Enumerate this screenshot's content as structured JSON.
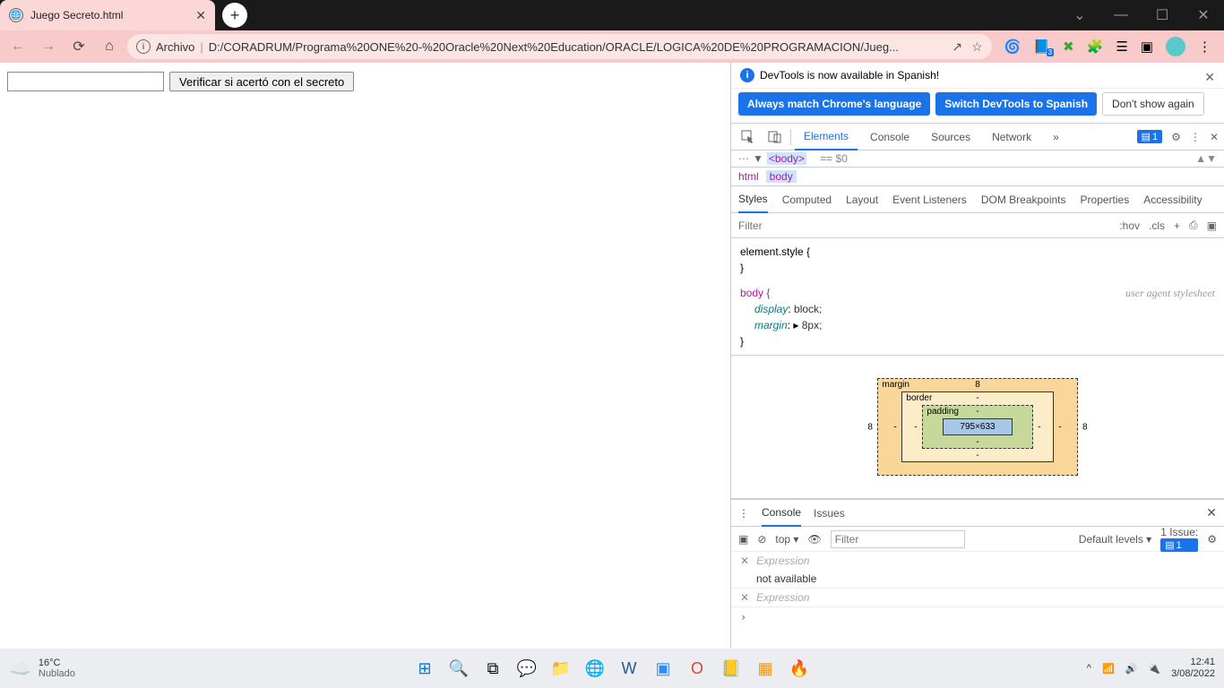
{
  "tab": {
    "title": "Juego Secreto.html"
  },
  "addr": {
    "label": "Archivo",
    "url": "D:/CORADRUM/Programa%20ONE%20-%20Oracle%20Next%20Education/ORACLE/LOGICA%20DE%20PROGRAMACION/Jueg..."
  },
  "page": {
    "button": "Verificar si acertó con el secreto"
  },
  "banner": {
    "text": "DevTools is now available in Spanish!",
    "b1": "Always match Chrome's language",
    "b2": "Switch DevTools to Spanish",
    "b3": "Don't show again"
  },
  "tabs": {
    "elements": "Elements",
    "console": "Console",
    "sources": "Sources",
    "network": "Network",
    "badge": "1"
  },
  "dom": {
    "body": "<body>",
    "eq": "== $0"
  },
  "crumb": {
    "html": "html",
    "body": "body"
  },
  "subtabs": {
    "styles": "Styles",
    "computed": "Computed",
    "layout": "Layout",
    "el": "Event Listeners",
    "db": "DOM Breakpoints",
    "props": "Properties",
    "acc": "Accessibility"
  },
  "filter": {
    "ph": "Filter",
    "hov": ":hov",
    "cls": ".cls"
  },
  "styles": {
    "es": "element.style {",
    "body": "body {",
    "uas": "user agent stylesheet",
    "disp_p": "display",
    "disp_v": "block;",
    "marg_p": "margin",
    "marg_v": "8px;",
    "close": "}"
  },
  "box": {
    "margin": "margin",
    "border": "border",
    "padding": "padding",
    "content": "795×633",
    "m8": "8",
    "dash": "-"
  },
  "drawer": {
    "console": "Console",
    "issues": "Issues",
    "top": "top ▾",
    "filter_ph": "Filter",
    "levels": "Default levels ▾",
    "issue": "1 Issue:",
    "issue_n": "1",
    "expr": "Expression",
    "na": "not available",
    "prompt": "›"
  },
  "tb": {
    "temp": "16°C",
    "weather": "Nublado",
    "time": "12:41",
    "date": "3/08/2022"
  }
}
